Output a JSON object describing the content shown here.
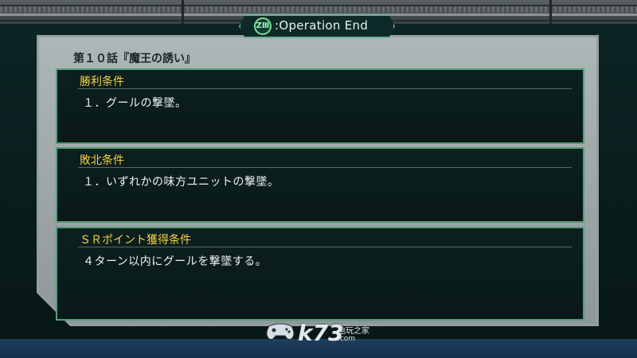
{
  "header": {
    "emblem_text": "ZⅢ",
    "title": ":Operation End"
  },
  "episode_title": "第１０話『魔王の誘い』",
  "panels": {
    "victory": {
      "heading": "勝利条件",
      "line": "１．グールの撃墜。"
    },
    "defeat": {
      "heading": "敗北条件",
      "line": "１．いずれかの味方ユニットの撃墜。"
    },
    "sr_point": {
      "heading": "ＳＲポイント獲得条件",
      "line": "４ターン以内にグールを撃墜する。"
    }
  },
  "watermark": {
    "logo": "k73",
    "site_name": "电玩之家",
    "domain": ".com"
  },
  "colors": {
    "heading_yellow": "#f2d247",
    "panel_border_green": "#51a077",
    "frame_gray": "#959ea0",
    "background_dark": "#0a1d1c"
  },
  "icons": [
    "zmn-emblem-icon",
    "gamepad-icon"
  ]
}
